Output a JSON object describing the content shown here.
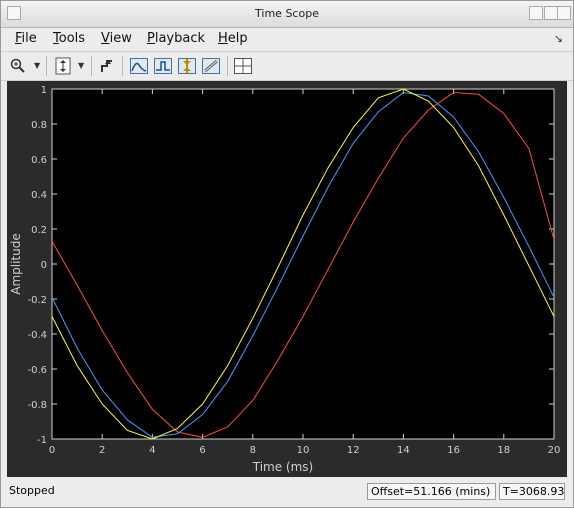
{
  "window": {
    "title": "Time Scope"
  },
  "menu": {
    "items": [
      "File",
      "Tools",
      "View",
      "Playback",
      "Help"
    ]
  },
  "toolbar": {
    "icons": [
      "zoom-icon",
      "dropdown-arrow-icon",
      "autoscale-icon",
      "dropdown-arrow-icon",
      "trigger-icon",
      "peak-finder-icon",
      "bilevel-icon",
      "cursor-icon",
      "measure-icon",
      "layout-icon"
    ]
  },
  "status": {
    "state": "Stopped",
    "offset": "Offset=51.166 (mins)",
    "time": "T=3068.93"
  },
  "chart_data": {
    "type": "line",
    "xlabel": "Time (ms)",
    "ylabel": "Amplitude",
    "xlim": [
      0,
      20
    ],
    "ylim": [
      -1,
      1
    ],
    "xticks": [
      0,
      2,
      4,
      6,
      8,
      10,
      12,
      14,
      16,
      18,
      20
    ],
    "yticks": [
      -1,
      -0.8,
      -0.6,
      -0.4,
      -0.2,
      0,
      0.2,
      0.4,
      0.6,
      0.8,
      1
    ],
    "grid": false,
    "background": "#000000",
    "series": [
      {
        "color": "#ff4a3a",
        "x": [
          0,
          1,
          2,
          3,
          4,
          5,
          6,
          7,
          8,
          9,
          10,
          11,
          12,
          13,
          14,
          15,
          16,
          17,
          18,
          19,
          20
        ],
        "y": [
          0.13,
          -0.12,
          -0.38,
          -0.62,
          -0.83,
          -0.96,
          -0.99,
          -0.93,
          -0.78,
          -0.55,
          -0.3,
          -0.03,
          0.24,
          0.49,
          0.72,
          0.88,
          0.98,
          0.97,
          0.86,
          0.66,
          0.14
        ]
      },
      {
        "color": "#3a9ffd",
        "x": [
          0,
          1,
          2,
          3,
          4,
          5,
          6,
          7,
          8,
          9,
          10,
          11,
          12,
          13,
          14,
          15,
          16,
          17,
          18,
          19,
          20
        ],
        "y": [
          -0.19,
          -0.48,
          -0.72,
          -0.89,
          -0.99,
          -0.97,
          -0.86,
          -0.67,
          -0.41,
          -0.13,
          0.16,
          0.44,
          0.69,
          0.87,
          0.98,
          0.96,
          0.84,
          0.64,
          0.38,
          0.1,
          -0.19
        ]
      },
      {
        "color": "#ffff2a",
        "x": [
          0,
          1,
          2,
          3,
          4,
          5,
          6,
          7,
          8,
          9,
          10,
          11,
          12,
          13,
          14,
          15,
          16,
          17,
          18,
          19,
          20
        ],
        "y": [
          -0.3,
          -0.58,
          -0.8,
          -0.95,
          -1.0,
          -0.94,
          -0.8,
          -0.58,
          -0.31,
          -0.02,
          0.28,
          0.55,
          0.78,
          0.95,
          1.0,
          0.93,
          0.78,
          0.56,
          0.28,
          -0.01,
          -0.3
        ]
      }
    ]
  }
}
